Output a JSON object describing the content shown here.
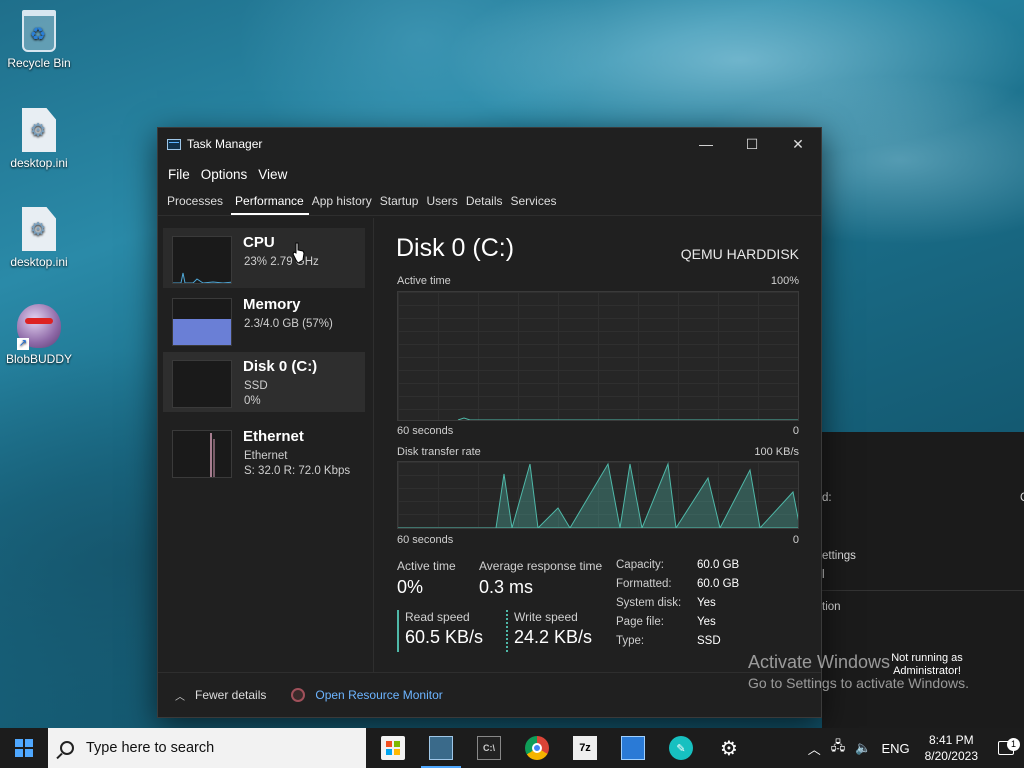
{
  "desktop": {
    "icons": [
      {
        "label": "Recycle Bin"
      },
      {
        "label": "desktop.ini"
      },
      {
        "label": "desktop.ini"
      },
      {
        "label": "BlobBUDDY"
      }
    ]
  },
  "window": {
    "title": "Task Manager",
    "menu": [
      "File",
      "Options",
      "View"
    ],
    "tabs": [
      "Processes",
      "Performance",
      "App history",
      "Startup",
      "Users",
      "Details",
      "Services"
    ],
    "active_tab": "Performance"
  },
  "resources": [
    {
      "name": "CPU",
      "sub1": "23%  2.79 GHz",
      "sub2": ""
    },
    {
      "name": "Memory",
      "sub1": "2.3/4.0 GB (57%)",
      "sub2": ""
    },
    {
      "name": "Disk 0 (C:)",
      "sub1": "SSD",
      "sub2": "0%"
    },
    {
      "name": "Ethernet",
      "sub1": "Ethernet",
      "sub2": "S: 32.0  R: 72.0 Kbps"
    }
  ],
  "detail": {
    "title": "Disk 0 (C:)",
    "model": "QEMU HARDDISK",
    "graph1": {
      "label": "Active time",
      "max": "100%",
      "time": "60 seconds",
      "min": "0"
    },
    "graph2": {
      "label": "Disk transfer rate",
      "max": "100 KB/s",
      "time": "60 seconds",
      "min": "0"
    },
    "stats": {
      "active_time_label": "Active time",
      "active_time_value": "0%",
      "avg_resp_label": "Average response time",
      "avg_resp_value": "0.3 ms",
      "read_label": "Read speed",
      "read_value": "60.5 KB/s",
      "write_label": "Write speed",
      "write_value": "24.2 KB/s"
    },
    "info": [
      {
        "k": "Capacity:",
        "v": "60.0 GB"
      },
      {
        "k": "Formatted:",
        "v": "60.0 GB"
      },
      {
        "k": "System disk:",
        "v": "Yes"
      },
      {
        "k": "Page file:",
        "v": "Yes"
      },
      {
        "k": "Type:",
        "v": "SSD"
      }
    ]
  },
  "footer": {
    "fewer_details": "Fewer details",
    "open_resource_monitor": "Open Resource Monitor"
  },
  "background_window": {
    "lines": [
      "d:",
      "C",
      "ettings",
      "l",
      "tion"
    ]
  },
  "watermark": {
    "line1": "Activate Windows",
    "line2": "Go to Settings to activate Windows.",
    "not_running": "Not running as Administrator!"
  },
  "taskbar": {
    "search_placeholder": "Type here to search",
    "language": "ENG",
    "time": "8:41 PM",
    "date": "8/20/2023",
    "notification_count": "1",
    "apps": [
      "store-icon",
      "task-manager-icon",
      "cmd-icon",
      "chrome-icon",
      "7zip-icon",
      "app-icon",
      "feather-app-icon",
      "settings-icon"
    ]
  },
  "colors": {
    "accent": "#4fa8ff",
    "disk_graph": "#4fb8a8",
    "memory_fill": "#6a7fd6",
    "ethernet_line": "#d8a0b8",
    "link": "#6cb4ff"
  }
}
